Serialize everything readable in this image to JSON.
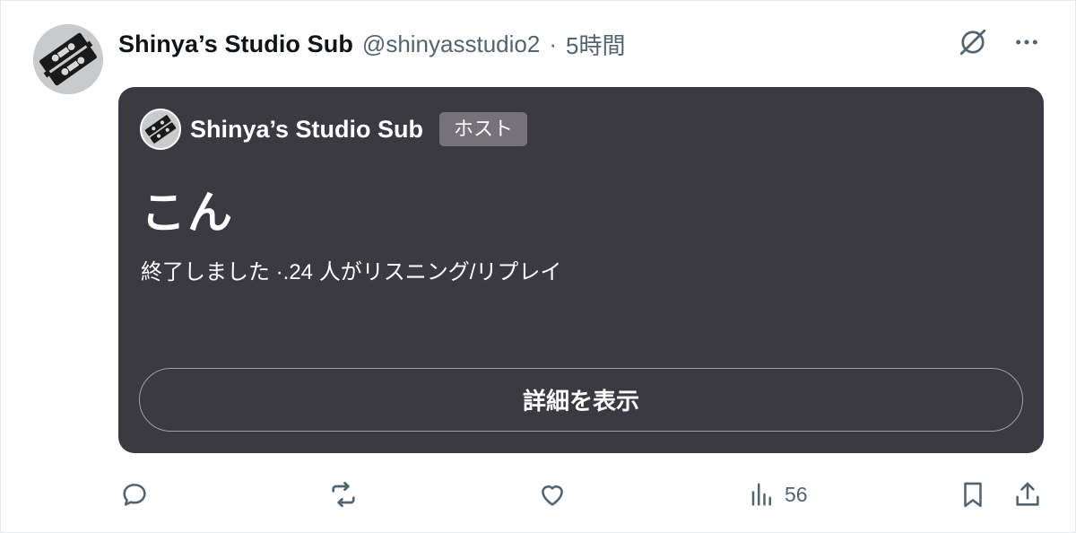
{
  "post": {
    "display_name": "Shinya’s Studio Sub",
    "handle": "@shinyasstudio2",
    "separator": "·",
    "time": "5時間",
    "avatar_icon": "cassette-logo-avatar",
    "header_icons": [
      "grok-icon",
      "more-icon"
    ]
  },
  "space": {
    "host_name": "Shinya’s Studio Sub",
    "host_badge": "ホスト",
    "title": "こん",
    "status": "終了しました ·.24 人がリスニング/リプレイ",
    "details_button": "詳細を表示",
    "background_color": "#3b3941"
  },
  "actions": {
    "reply_icon": "reply-icon",
    "repost_icon": "repost-icon",
    "like_icon": "like-icon",
    "views_icon": "views-icon",
    "views_count": "56",
    "bookmark_icon": "bookmark-icon",
    "share_icon": "share-icon"
  },
  "colors": {
    "text_primary": "#0f1419",
    "text_secondary": "#536471",
    "card_background": "#3b3941",
    "badge_background": "#757279"
  }
}
